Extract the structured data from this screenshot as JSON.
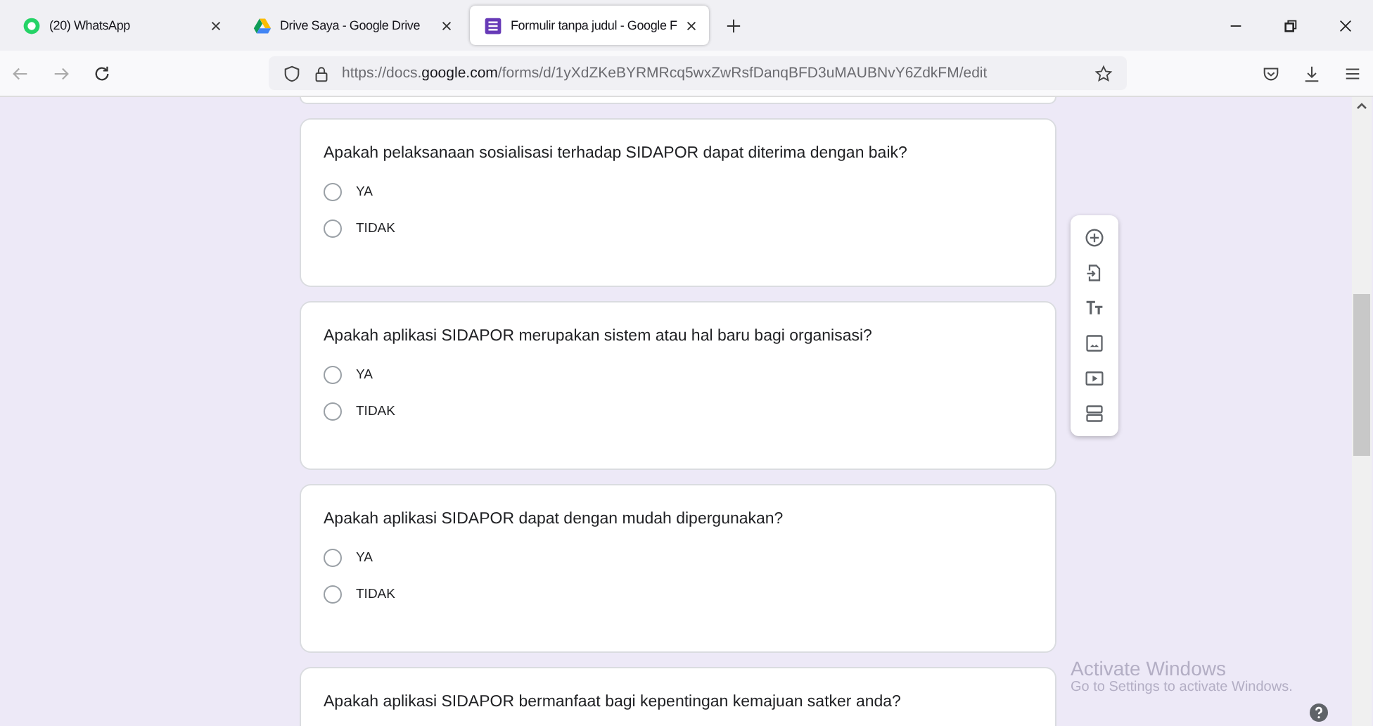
{
  "browser": {
    "tabs": [
      {
        "title": "(20) WhatsApp",
        "selected": false
      },
      {
        "title": "Drive Saya - Google Drive",
        "selected": false
      },
      {
        "title": "Formulir tanpa judul - Google F",
        "selected": true
      }
    ],
    "url": "https://docs.**google.com**/forms/d/1yXdZKeBYRMRcq5wxZwRsfDanqBFD3uMAUBNvY6ZdkFM/edit"
  },
  "questions": [
    {
      "text": "Apakah pelaksanaan sosialisasi terhadap SIDAPOR dapat diterima dengan baik?",
      "options": [
        {
          "label": "YA",
          "selected": false
        },
        {
          "label": "TIDAK",
          "selected": false
        }
      ]
    },
    {
      "text": "Apakah aplikasi SIDAPOR merupakan sistem atau hal baru bagi organisasi?",
      "options": [
        {
          "label": "YA",
          "selected": false
        },
        {
          "label": "TIDAK",
          "selected": false
        }
      ]
    },
    {
      "text": "Apakah aplikasi SIDAPOR dapat dengan mudah dipergunakan?",
      "options": [
        {
          "label": "YA",
          "selected": false
        },
        {
          "label": "TIDAK",
          "selected": false
        }
      ]
    },
    {
      "text": "Apakah aplikasi SIDAPOR bermanfaat bagi kepentingan kemajuan satker anda?"
    }
  ],
  "toolbar": [
    {
      "kind": "add"
    },
    {
      "kind": "import"
    },
    {
      "kind": "title"
    },
    {
      "kind": "image"
    },
    {
      "kind": "video"
    },
    {
      "kind": "section"
    }
  ],
  "os_notice": {
    "title": "Activate Windows",
    "subtitle": "Go to Settings to activate Windows."
  }
}
